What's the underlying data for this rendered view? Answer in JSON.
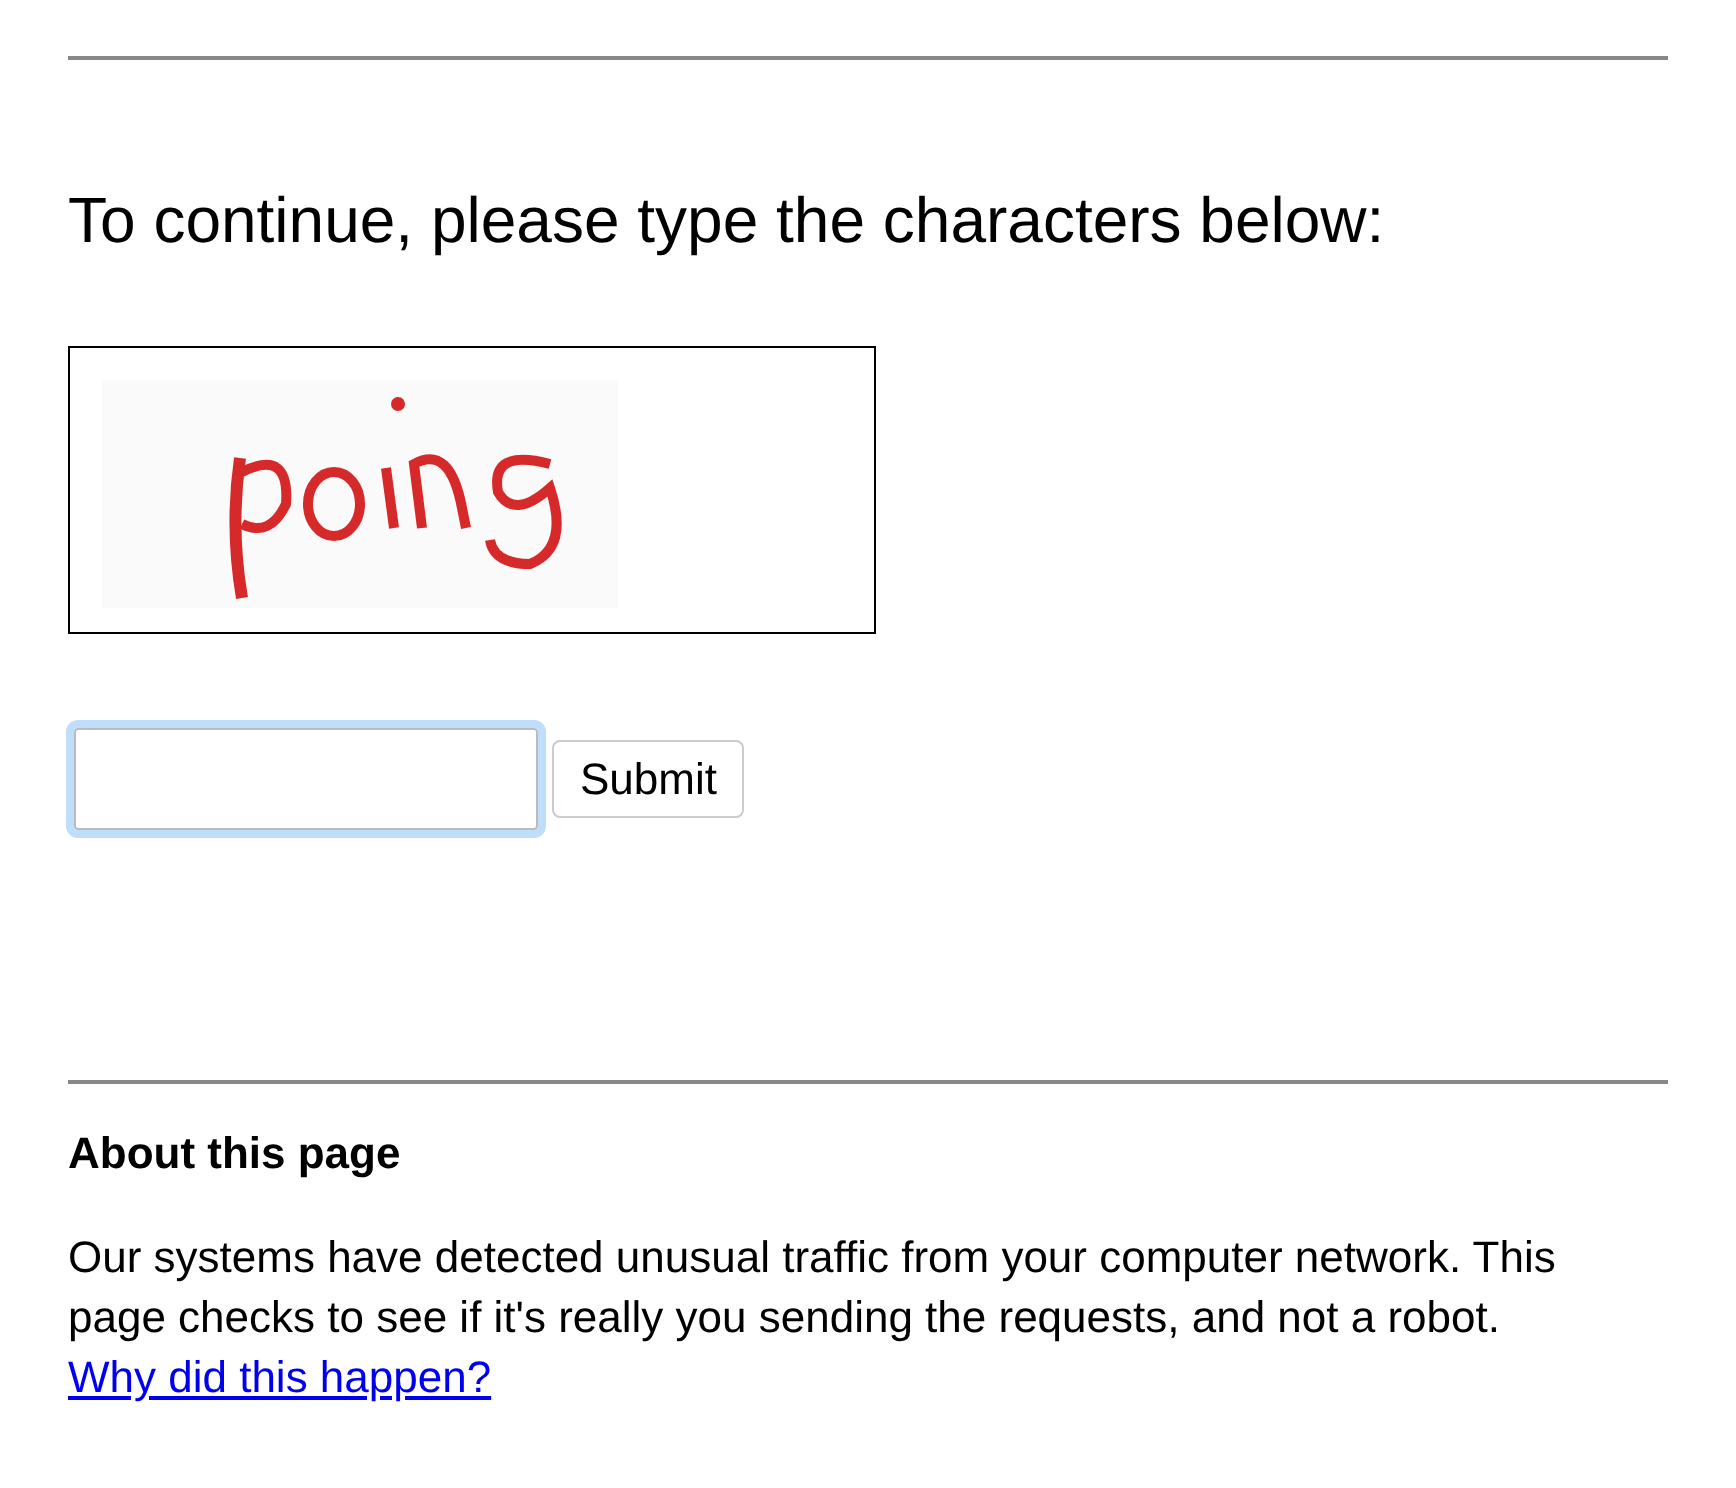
{
  "prompt": "To continue, please type the characters below:",
  "answer_field": {
    "focused": true
  },
  "submit_button": "Submit",
  "about": {
    "heading": "About this page",
    "text": "Our systems have detected unusual traffic from your computer network. This page checks to see if it's really you sending the requests, and not a robot.",
    "link": "Why did this happen?"
  }
}
